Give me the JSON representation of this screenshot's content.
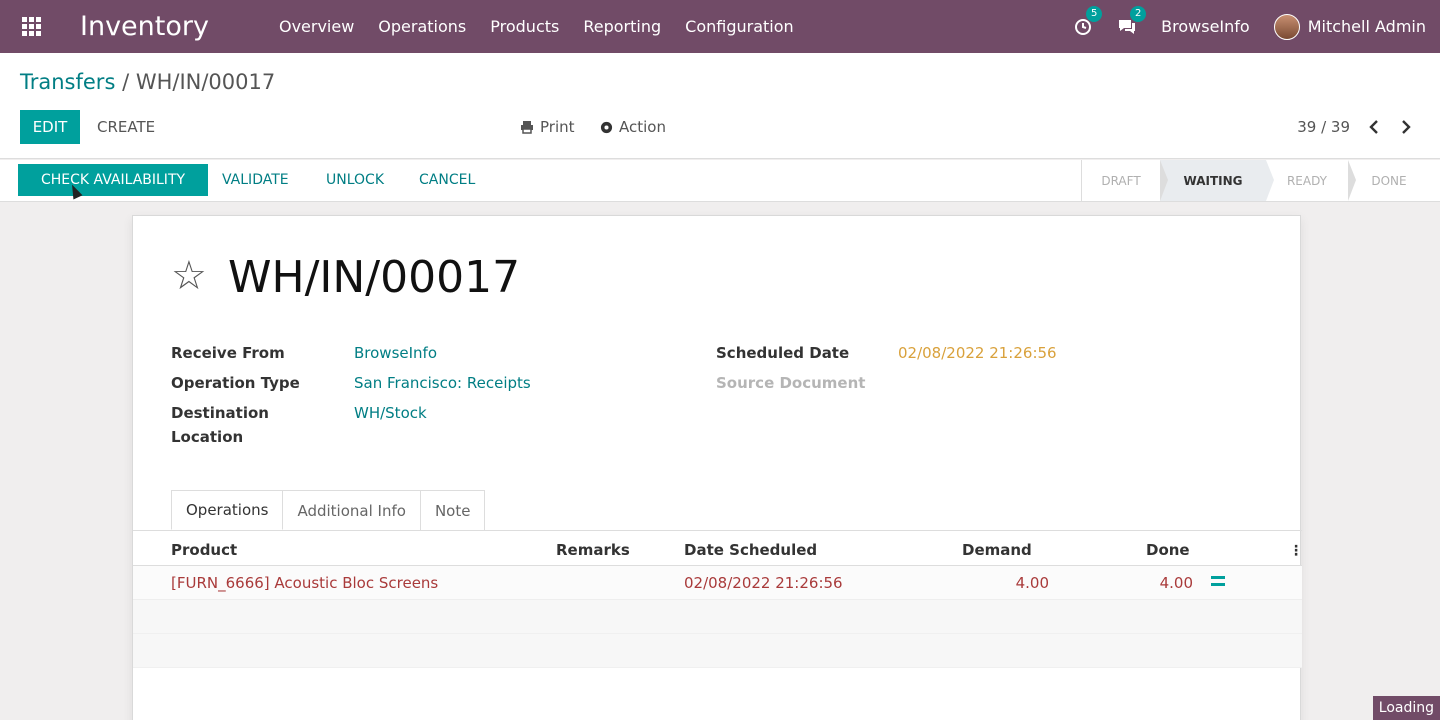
{
  "navbar": {
    "app_name": "Inventory",
    "menu": [
      "Overview",
      "Operations",
      "Products",
      "Reporting",
      "Configuration"
    ],
    "activity_count": "5",
    "messages_count": "2",
    "company": "BrowseInfo",
    "user": "Mitchell Admin"
  },
  "breadcrumb": {
    "parent": "Transfers",
    "separator": " / ",
    "current": "WH/IN/00017"
  },
  "control": {
    "edit_label": "EDIT",
    "create_label": "CREATE",
    "print_label": "Print",
    "action_label": "Action",
    "pager": "39 / 39"
  },
  "statusbar": {
    "buttons": [
      "CHECK AVAILABILITY",
      "VALIDATE",
      "UNLOCK",
      "CANCEL"
    ],
    "stages": [
      "DRAFT",
      "WAITING",
      "READY",
      "DONE"
    ],
    "active_stage": "WAITING"
  },
  "record": {
    "title": "WH/IN/00017",
    "receive_from_label": "Receive From",
    "receive_from": "BrowseInfo",
    "operation_type_label": "Operation Type",
    "operation_type": "San Francisco: Receipts",
    "destination_label_1": "Destination",
    "destination_label_2": "Location",
    "destination": "WH/Stock",
    "scheduled_date_label": "Scheduled Date",
    "scheduled_date": "02/08/2022 21:26:56",
    "source_document_label": "Source Document"
  },
  "tabs": [
    "Operations",
    "Additional Info",
    "Note"
  ],
  "table": {
    "headers": [
      "Product",
      "Remarks",
      "Date Scheduled",
      "Demand",
      "Done"
    ],
    "rows": [
      {
        "product": "[FURN_6666] Acoustic Bloc Screens",
        "remarks": "",
        "date": "02/08/2022 21:26:56",
        "demand": "4.00",
        "done": "4.00"
      }
    ]
  },
  "loading_text": "Loading",
  "colors": {
    "brand": "#714b67",
    "accent": "#00a09d",
    "link": "#017e84",
    "warning": "#d9a13b",
    "late": "#a93a3a"
  }
}
